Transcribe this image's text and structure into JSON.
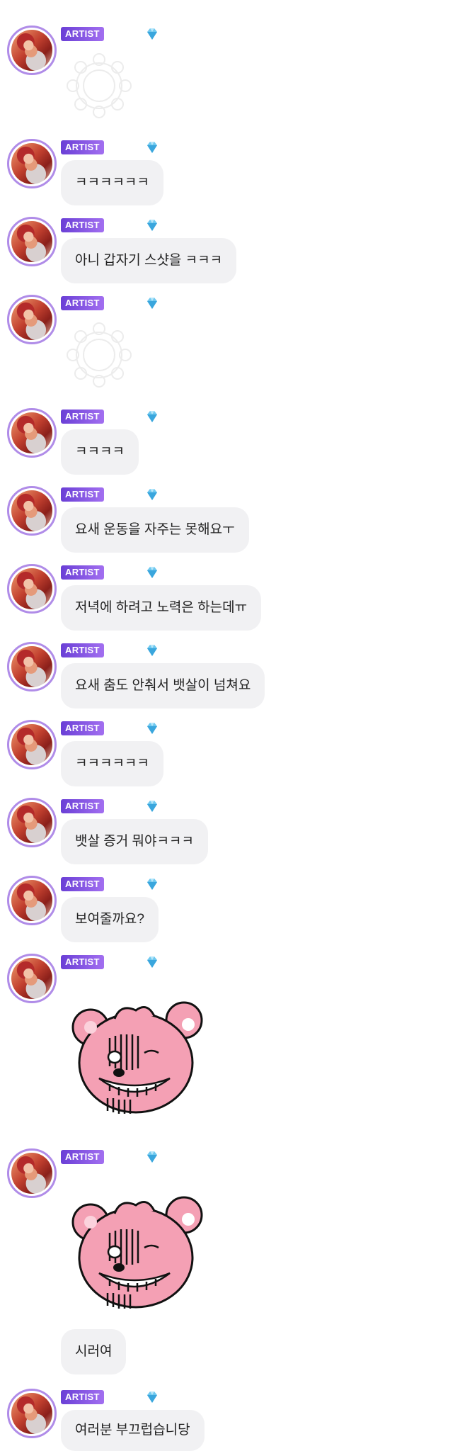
{
  "badge_label": "ARTIST",
  "icons": {
    "gem": "gem-icon",
    "loading": "loading-sticker-icon",
    "bear": "bear-sticker"
  },
  "colors": {
    "badge_start": "#6a3fd6",
    "badge_end": "#a26ff0",
    "bubble_bg": "#f1f1f3",
    "avatar_ring": "#b08ce8",
    "bear_pink": "#f4a0b4"
  },
  "messages": [
    {
      "type": "loading-sticker"
    },
    {
      "type": "text",
      "text": "ㅋㅋㅋㅋㅋㅋ"
    },
    {
      "type": "text",
      "text": "아니 갑자기 스샷을 ㅋㅋㅋ"
    },
    {
      "type": "loading-sticker"
    },
    {
      "type": "text",
      "text": "ㅋㅋㅋㅋ"
    },
    {
      "type": "text",
      "text": "요새 운동을 자주는 못해요ㅜ"
    },
    {
      "type": "text",
      "text": "저녁에 하려고 노력은 하는데ㅠ"
    },
    {
      "type": "text",
      "text": "요새 춤도 안춰서 뱃살이 넘쳐요"
    },
    {
      "type": "text",
      "text": "ㅋㅋㅋㅋㅋㅋ"
    },
    {
      "type": "text",
      "text": "뱃살 증거 뭐야ㅋㅋㅋ"
    },
    {
      "type": "text",
      "text": "보여줄까요?"
    },
    {
      "type": "bear-sticker"
    },
    {
      "type": "bear-sticker"
    },
    {
      "type": "text",
      "text": "시러여",
      "continuation": true
    },
    {
      "type": "text",
      "text": "여러분 부끄럽습니당"
    }
  ]
}
